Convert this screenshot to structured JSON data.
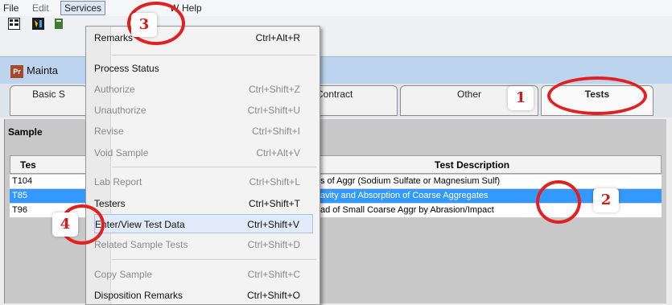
{
  "menubar": {
    "items": [
      {
        "label": "File"
      },
      {
        "label": "Edit"
      },
      {
        "label": "Services"
      },
      {
        "label": "W"
      },
      {
        "label": "Help"
      }
    ]
  },
  "window": {
    "title": "Mainta"
  },
  "tabs": [
    {
      "label": "Basic S"
    },
    {
      "label": "Contract"
    },
    {
      "label": "Other"
    },
    {
      "label": "Tests"
    }
  ],
  "sample": {
    "label": "Sample"
  },
  "grid": {
    "headers": [
      "Tes",
      "Test Description"
    ],
    "rows": [
      {
        "code": "T104",
        "description": "s of Aggr (Sodium Sulfate or Magnesium Sulf)"
      },
      {
        "code": "T85",
        "description": "avity and Absorption of Coarse Aggregates"
      },
      {
        "code": "T96",
        "description": "ad of Small Coarse Aggr by Abrasion/Impact"
      }
    ]
  },
  "services_menu": {
    "items": [
      {
        "label": "Remarks",
        "shortcut": "Ctrl+Alt+R"
      },
      {
        "label": "Process Status",
        "shortcut": ""
      },
      {
        "label": "Authorize",
        "shortcut": "Ctrl+Shift+Z"
      },
      {
        "label": "Unauthorize",
        "shortcut": "Ctrl+Shift+U"
      },
      {
        "label": "Revise",
        "shortcut": "Ctrl+Shift+I"
      },
      {
        "label": "Void Sample",
        "shortcut": "Ctrl+Alt+V"
      },
      {
        "label": "Lab Report",
        "shortcut": "Ctrl+Shift+L"
      },
      {
        "label": "Testers",
        "shortcut": "Ctrl+Shift+T"
      },
      {
        "label": "Enter/View Test Data",
        "shortcut": "Ctrl+Shift+V"
      },
      {
        "label": "Related Sample Tests",
        "shortcut": "Ctrl+Shift+D"
      },
      {
        "label": "Copy Sample",
        "shortcut": "Ctrl+Shift+C"
      },
      {
        "label": "Disposition Remarks",
        "shortcut": "Ctrl+Shift+O"
      }
    ]
  },
  "annotations": {
    "badges": [
      "1",
      "2",
      "3",
      "4"
    ],
    "color": "#e32020"
  },
  "colors": {
    "selection": "#3399ff",
    "menu_bg": "#f3f3f3",
    "annotation_red": "#e32020"
  }
}
